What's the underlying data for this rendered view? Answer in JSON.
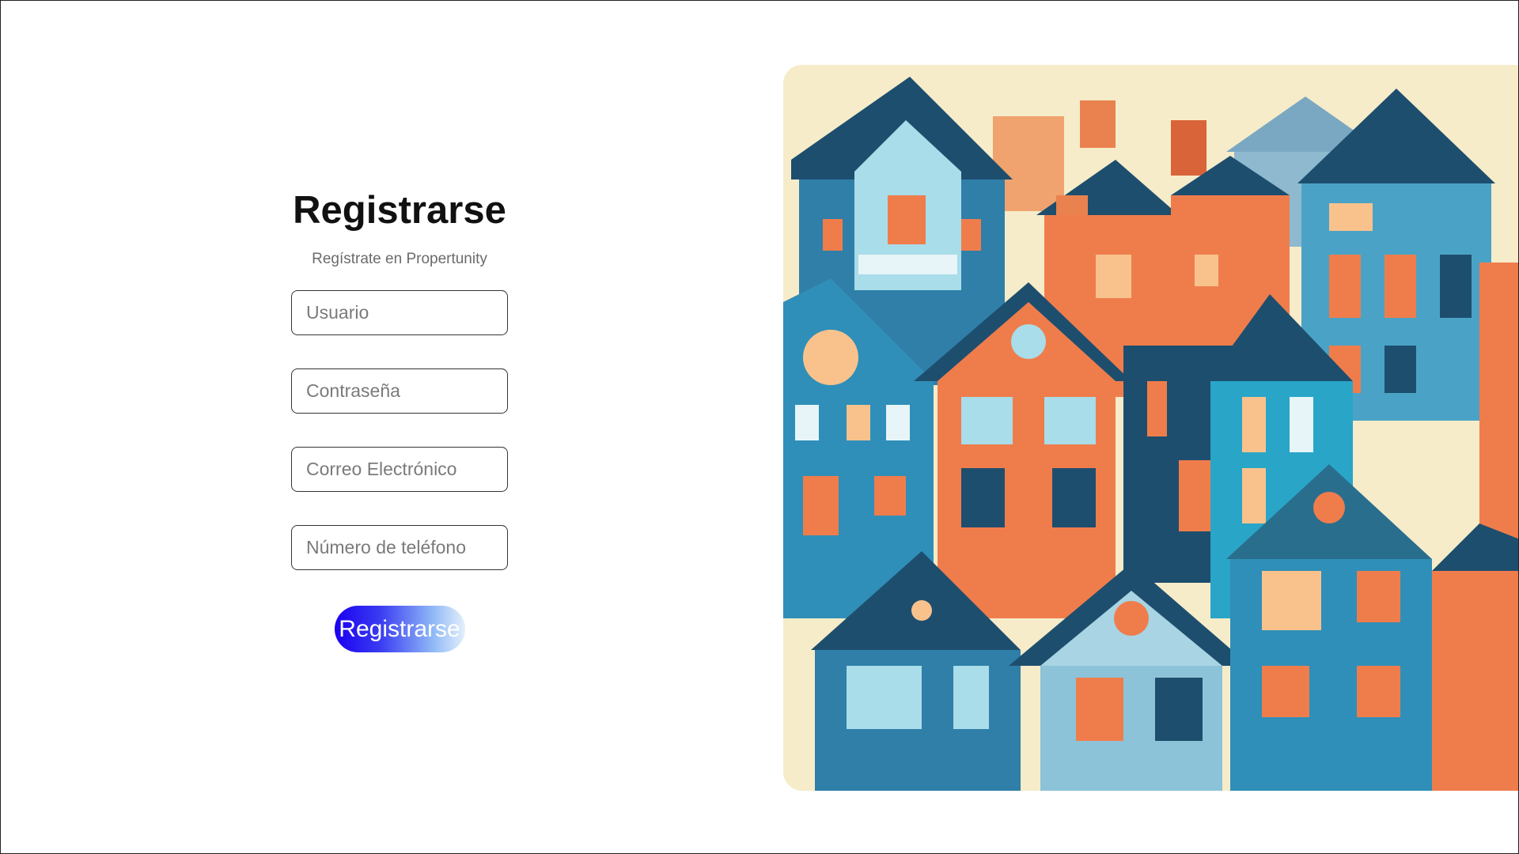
{
  "form": {
    "title": "Registrarse",
    "subtitle": "Regístrate en Propertunity",
    "fields": {
      "username_placeholder": "Usuario",
      "password_placeholder": "Contraseña",
      "email_placeholder": "Correo Electrónico",
      "phone_placeholder": "Número de teléfono"
    },
    "submit_label": "Registrarse"
  },
  "colors": {
    "button_gradient_start": "#1a00f0",
    "button_gradient_end": "#e4f0fb",
    "illustration_blue": "#2f8fb8",
    "illustration_orange": "#ef7d4c",
    "illustration_navy": "#1e4e6e",
    "illustration_cream": "#f6ecc9"
  }
}
